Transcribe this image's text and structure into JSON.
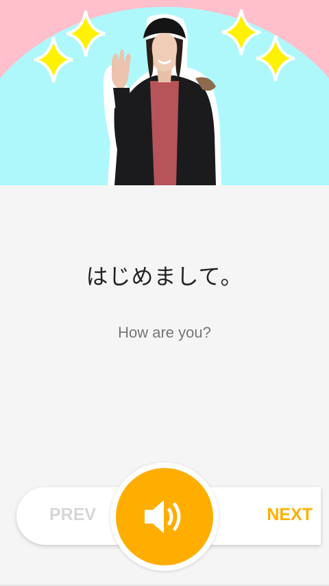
{
  "phrase": {
    "japanese": "はじめまして。",
    "english": "How are you?"
  },
  "controls": {
    "prev_label": "PREV",
    "next_label": "NEXT"
  },
  "colors": {
    "accent": "#ffae00",
    "hero_background": "#ffc0cb",
    "hero_dome": "#aef8fc",
    "sparkle": "#fff200",
    "prev_disabled": "#d6d6d6"
  },
  "icons": {
    "audio": "speaker-icon",
    "decoration": "sparkle-icon"
  }
}
